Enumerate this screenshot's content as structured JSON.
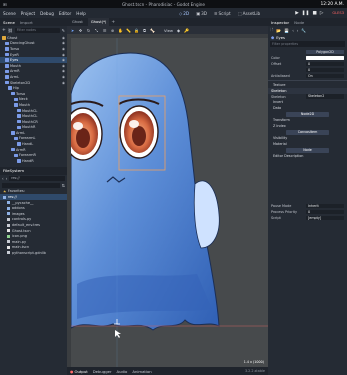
{
  "system": {
    "window_title": "Ghost.tscn - Pharodisiac - Godot Engine",
    "clock": "12:20 A.M."
  },
  "menu": [
    "Scene",
    "Project",
    "Debug",
    "Editor",
    "Help"
  ],
  "workspaces": [
    {
      "label": "2D",
      "active": true
    },
    {
      "label": "3D",
      "active": false
    },
    {
      "label": "Script",
      "active": false
    },
    {
      "label": "AssetLib",
      "active": false
    }
  ],
  "renderer": "GLES3",
  "scene_dock": {
    "tabs": [
      "Scene",
      "Import"
    ],
    "filter_placeholder": "Filter nodes",
    "nodes": [
      {
        "label": "Ghost",
        "depth": 0,
        "color": "#e0a93c",
        "eye": true
      },
      {
        "label": "DancingGhost",
        "depth": 1,
        "color": "#7b9be8",
        "eye": true
      },
      {
        "label": "Torso",
        "depth": 1,
        "color": "#7b9be8",
        "eye": true
      },
      {
        "label": "EyeR",
        "depth": 1,
        "color": "#7b9be8",
        "eye": true
      },
      {
        "label": "Eyes",
        "depth": 1,
        "color": "#7b9be8",
        "eye": true,
        "selected": true
      },
      {
        "label": "Mouth",
        "depth": 1,
        "color": "#7b9be8",
        "eye": true
      },
      {
        "label": "ArmR",
        "depth": 1,
        "color": "#7b9be8",
        "eye": true
      },
      {
        "label": "ArmL",
        "depth": 1,
        "color": "#7b9be8",
        "eye": true
      },
      {
        "label": "Skeleton2D",
        "depth": 1,
        "color": "#7b9be8",
        "eye": true
      },
      {
        "label": "Hip",
        "depth": 2,
        "color": "#7b9be8",
        "eye": false
      },
      {
        "label": "Torso",
        "depth": 3,
        "color": "#7b9be8",
        "eye": false
      },
      {
        "label": "Neck",
        "depth": 4,
        "color": "#7b9be8",
        "eye": false
      },
      {
        "label": "Mouth",
        "depth": 4,
        "color": "#7b9be8",
        "eye": false
      },
      {
        "label": "MouthCL",
        "depth": 5,
        "color": "#7b9be8",
        "eye": false
      },
      {
        "label": "MouthCL",
        "depth": 5,
        "color": "#7b9be8",
        "eye": false
      },
      {
        "label": "MouthCR",
        "depth": 5,
        "color": "#7b9be8",
        "eye": false
      },
      {
        "label": "MouthR",
        "depth": 5,
        "color": "#7b9be8",
        "eye": false
      },
      {
        "label": "ArmL",
        "depth": 3,
        "color": "#7b9be8",
        "eye": false
      },
      {
        "label": "ForearmL",
        "depth": 4,
        "color": "#7b9be8",
        "eye": false
      },
      {
        "label": "HandL",
        "depth": 5,
        "color": "#7b9be8",
        "eye": false
      },
      {
        "label": "ArmR",
        "depth": 3,
        "color": "#7b9be8",
        "eye": false
      },
      {
        "label": "ForearmR",
        "depth": 4,
        "color": "#7b9be8",
        "eye": false
      },
      {
        "label": "HandR",
        "depth": 5,
        "color": "#7b9be8",
        "eye": false
      }
    ]
  },
  "filesystem": {
    "title": "FileSystem",
    "path": "res://",
    "favorites_label": "Favorites:",
    "items": [
      {
        "label": "res://",
        "depth": 0,
        "kind": "folder",
        "selected": true
      },
      {
        "label": "__pycache__",
        "depth": 1,
        "kind": "folder"
      },
      {
        "label": "addons",
        "depth": 1,
        "kind": "folder"
      },
      {
        "label": "images",
        "depth": 1,
        "kind": "folder"
      },
      {
        "label": "controls.py",
        "depth": 1,
        "kind": "file"
      },
      {
        "label": "default_env.tres",
        "depth": 1,
        "kind": "file"
      },
      {
        "label": "Ghost.tscn",
        "depth": 1,
        "kind": "scene"
      },
      {
        "label": "icon.png",
        "depth": 1,
        "kind": "image"
      },
      {
        "label": "main.py",
        "depth": 1,
        "kind": "file"
      },
      {
        "label": "main.tscn",
        "depth": 1,
        "kind": "scene"
      },
      {
        "label": "pythonscript.gdnlib",
        "depth": 1,
        "kind": "file"
      }
    ]
  },
  "editor": {
    "tabs": [
      "Ghost",
      "Ghost(*)"
    ],
    "view_label": "View",
    "coords": "1.4 x (1000)",
    "bottom_tabs": [
      "Output",
      "Debugger",
      "Audio",
      "Animation"
    ],
    "version": "3.2.2.stable"
  },
  "inspector": {
    "tabs": [
      "Inspector",
      "Node"
    ],
    "node_name": "Eyes",
    "filter_placeholder": "Filter properties",
    "texture_resource": "Polygon2D",
    "color_label": "Color",
    "offset_label": "Offset",
    "offset_x": "0",
    "offset_y": "0",
    "antialiased_label": "Antialiased",
    "antialiased_value": "On",
    "texture_section": "Texture",
    "skeleton_section": "Skeleton",
    "skeleton_label": "Skeleton",
    "skeleton_value": "Skeleton2",
    "invert_label": "Invert",
    "data_label": "Data",
    "node2d_label": "Node2D",
    "transform_label": "Transform",
    "zindex_label": "Z Index",
    "canvasitem_label": "CanvasItem",
    "visibility_label": "Visibility",
    "material_label": "Material",
    "node_btn": "Node",
    "editor_desc_label": "Editor Description",
    "pause_mode_label": "Pause Mode",
    "pause_mode_value": "Inherit",
    "priority_label": "Process Priority",
    "priority_value": "0",
    "script_label": "Script",
    "script_value": "[empty]"
  },
  "colors": {
    "accent": "#75a8ff",
    "selection": "#2f4a6b",
    "ghost_blue": "#5b8fd6",
    "eye_orange": "#e8895a"
  }
}
